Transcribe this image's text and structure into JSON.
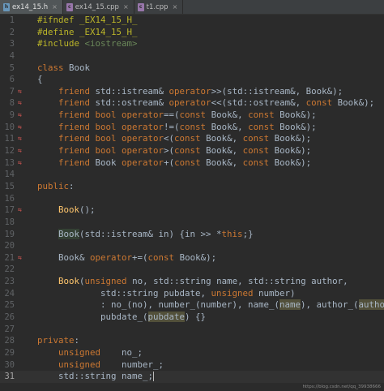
{
  "tabs": [
    {
      "label": "ex14_15.h",
      "icon": "header-file-icon",
      "active": true
    },
    {
      "label": "ex14_15.cpp",
      "icon": "cpp-file-icon",
      "active": false
    },
    {
      "label": "t1.cpp",
      "icon": "cpp-file-icon",
      "active": false
    }
  ],
  "lines": [
    {
      "n": "1",
      "segs": [
        [
          "pp",
          "#ifndef _EX14_15_H_"
        ]
      ]
    },
    {
      "n": "2",
      "segs": [
        [
          "pp",
          "#define _EX14_15_H_"
        ]
      ]
    },
    {
      "n": "3",
      "segs": [
        [
          "pp",
          "#include "
        ],
        [
          "str",
          "<iostream>"
        ]
      ]
    },
    {
      "n": "4",
      "segs": []
    },
    {
      "n": "5",
      "segs": [
        [
          "kw",
          "class"
        ],
        [
          "",
          "Book"
        ]
      ],
      "sep": " "
    },
    {
      "n": "6",
      "segs": [
        [
          "",
          "{"
        ]
      ]
    },
    {
      "n": "7",
      "gutter": "override",
      "segs": [
        [
          "",
          "    "
        ],
        [
          "kw",
          "friend "
        ],
        [
          "",
          "std::istream& "
        ],
        [
          "kw",
          "operator"
        ],
        [
          "",
          ">>(std::istream&, Book&);"
        ]
      ]
    },
    {
      "n": "8",
      "gutter": "override",
      "segs": [
        [
          "",
          "    "
        ],
        [
          "kw",
          "friend "
        ],
        [
          "",
          "std::ostream& "
        ],
        [
          "kw",
          "operator"
        ],
        [
          "",
          "<<(std::ostream&, "
        ],
        [
          "kw",
          "const "
        ],
        [
          "",
          "Book&);"
        ]
      ]
    },
    {
      "n": "9",
      "gutter": "override",
      "segs": [
        [
          "",
          "    "
        ],
        [
          "kw",
          "friend bool operator"
        ],
        [
          "",
          "==("
        ],
        [
          "kw",
          "const "
        ],
        [
          "",
          "Book&, "
        ],
        [
          "kw",
          "const "
        ],
        [
          "",
          "Book&);"
        ]
      ]
    },
    {
      "n": "10",
      "gutter": "override",
      "segs": [
        [
          "",
          "    "
        ],
        [
          "kw",
          "friend bool operator"
        ],
        [
          "",
          "!=("
        ],
        [
          "kw",
          "const "
        ],
        [
          "",
          "Book&, "
        ],
        [
          "kw",
          "const "
        ],
        [
          "",
          "Book&);"
        ]
      ]
    },
    {
      "n": "11",
      "gutter": "override",
      "segs": [
        [
          "",
          "    "
        ],
        [
          "kw",
          "friend bool operator"
        ],
        [
          "",
          "<("
        ],
        [
          "kw",
          "const "
        ],
        [
          "",
          "Book&, "
        ],
        [
          "kw",
          "const "
        ],
        [
          "",
          "Book&);"
        ]
      ]
    },
    {
      "n": "12",
      "gutter": "override",
      "segs": [
        [
          "",
          "    "
        ],
        [
          "kw",
          "friend bool operator"
        ],
        [
          "",
          ">("
        ],
        [
          "kw",
          "const "
        ],
        [
          "",
          "Book&, "
        ],
        [
          "kw",
          "const "
        ],
        [
          "",
          "Book&);"
        ]
      ]
    },
    {
      "n": "13",
      "gutter": "override",
      "segs": [
        [
          "",
          "    "
        ],
        [
          "kw",
          "friend "
        ],
        [
          "",
          "Book "
        ],
        [
          "kw",
          "operator"
        ],
        [
          "",
          "+("
        ],
        [
          "kw",
          "const "
        ],
        [
          "",
          "Book&, "
        ],
        [
          "kw",
          "const "
        ],
        [
          "",
          "Book&);"
        ]
      ]
    },
    {
      "n": "14",
      "segs": []
    },
    {
      "n": "15",
      "segs": [
        [
          "kw",
          "public"
        ],
        [
          "",
          ":"
        ]
      ]
    },
    {
      "n": "16",
      "segs": []
    },
    {
      "n": "17",
      "gutter": "override",
      "segs": [
        [
          "",
          "    "
        ],
        [
          "fn",
          "Book"
        ],
        [
          "",
          "();"
        ]
      ]
    },
    {
      "n": "18",
      "segs": []
    },
    {
      "n": "19",
      "segs": [
        [
          "",
          "    "
        ],
        [
          "hl",
          "Book"
        ],
        [
          "",
          "(std::istream& in) {in >> *"
        ],
        [
          "kw",
          "this"
        ],
        [
          "",
          ";}"
        ]
      ]
    },
    {
      "n": "20",
      "segs": []
    },
    {
      "n": "21",
      "gutter": "override",
      "segs": [
        [
          "",
          "    Book& "
        ],
        [
          "kw",
          "operator"
        ],
        [
          "",
          "+=("
        ],
        [
          "kw",
          "const "
        ],
        [
          "",
          "Book&);"
        ]
      ]
    },
    {
      "n": "22",
      "segs": []
    },
    {
      "n": "23",
      "segs": [
        [
          "",
          "    "
        ],
        [
          "fn",
          "Book"
        ],
        [
          "",
          "("
        ],
        [
          "kw",
          "unsigned "
        ],
        [
          "",
          "no, std::string name, std::string author,"
        ]
      ]
    },
    {
      "n": "24",
      "segs": [
        [
          "",
          "            std::string pubdate, "
        ],
        [
          "kw",
          "unsigned "
        ],
        [
          "",
          "number)"
        ]
      ]
    },
    {
      "n": "25",
      "segs": [
        [
          "",
          "            : no_(no), number_(number), name_("
        ],
        [
          "hl2",
          "name"
        ],
        [
          "",
          "), author_("
        ],
        [
          "hl2",
          "author"
        ],
        [
          "",
          "),"
        ]
      ]
    },
    {
      "n": "26",
      "segs": [
        [
          "",
          "            pubdate_("
        ],
        [
          "hl2",
          "pubdate"
        ],
        [
          "",
          ") {}"
        ]
      ]
    },
    {
      "n": "27",
      "segs": []
    },
    {
      "n": "28",
      "segs": [
        [
          "kw",
          "private"
        ],
        [
          "",
          ":"
        ]
      ]
    },
    {
      "n": "29",
      "segs": [
        [
          "",
          "    "
        ],
        [
          "kw",
          "unsigned    "
        ],
        [
          "",
          "no_;"
        ]
      ]
    },
    {
      "n": "30",
      "segs": [
        [
          "",
          "    "
        ],
        [
          "kw",
          "unsigned    "
        ],
        [
          "",
          "number_;"
        ]
      ]
    },
    {
      "n": "31",
      "current": true,
      "segs": [
        [
          "",
          "    std::string name_;"
        ]
      ]
    }
  ],
  "watermark": "https://blog.csdn.net/qq_39938666"
}
